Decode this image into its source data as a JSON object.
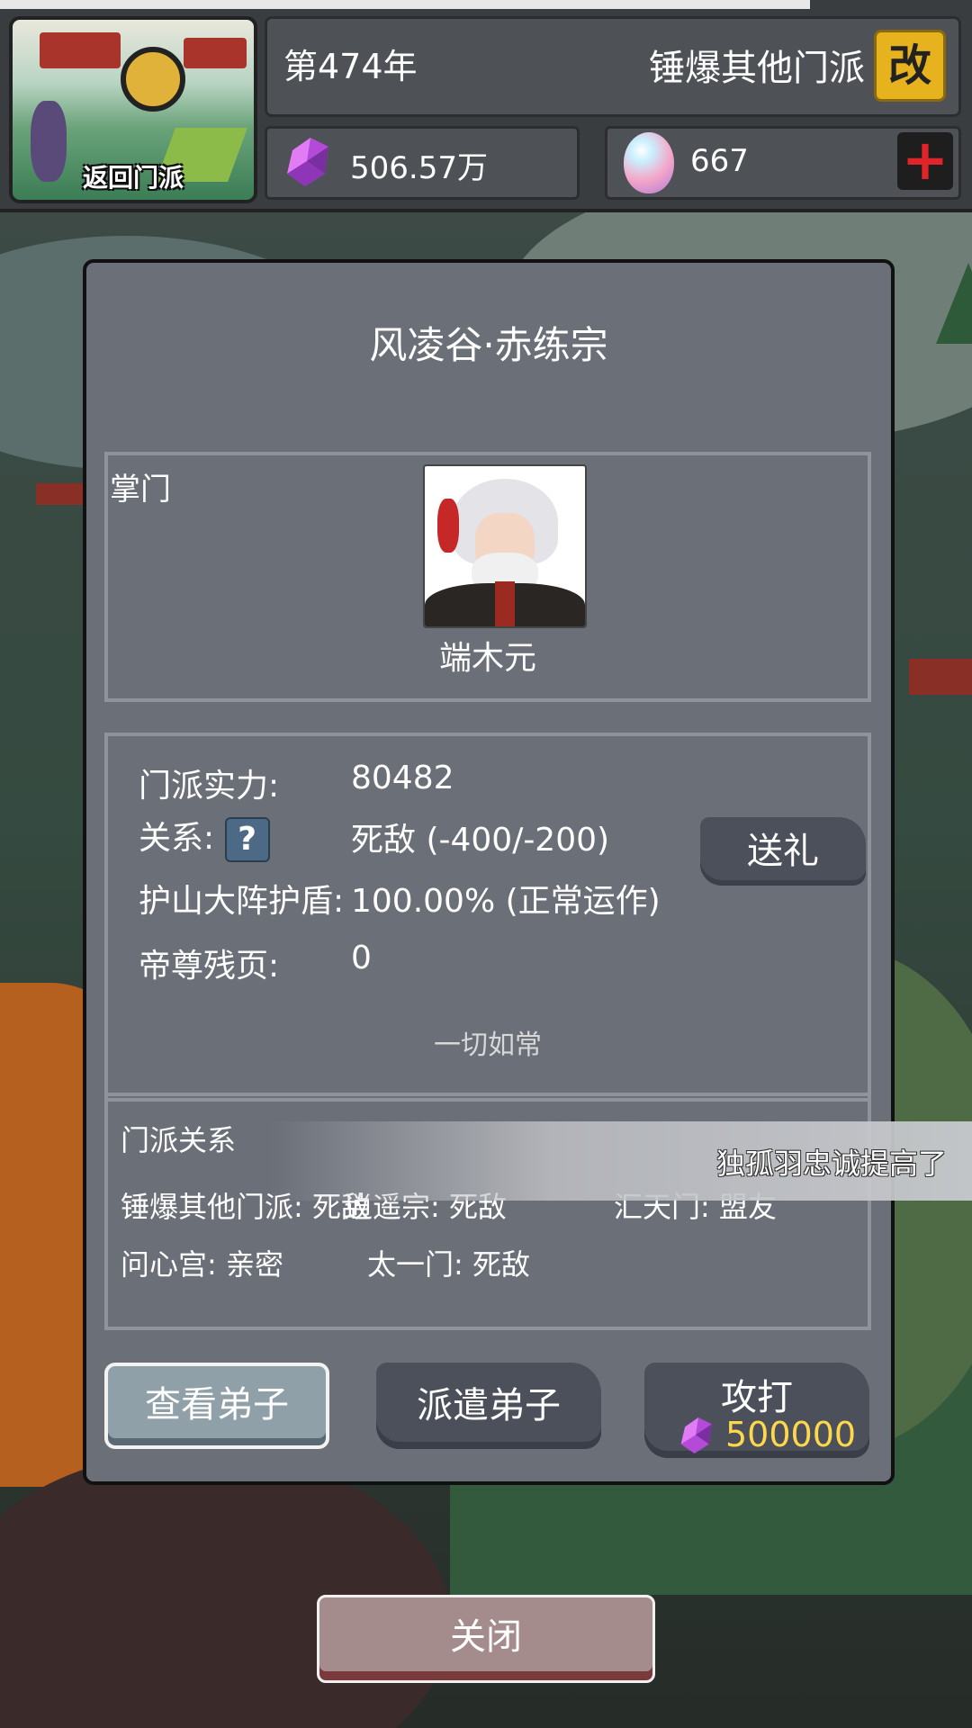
{
  "header": {
    "return_label": "返回门派",
    "year": "第474年",
    "sect_name": "锤爆其他门派",
    "rename_button": "改",
    "spirit_stones": "506.57万",
    "gems": "667",
    "add_button": "+"
  },
  "dialog": {
    "title": "风凌谷·赤练宗",
    "leader": {
      "section_label": "掌门",
      "name": "端木元"
    },
    "stats": {
      "power_label": "门派实力:",
      "power_value": "80482",
      "relation_label": "关系:",
      "relation_help": "?",
      "relation_value": "死敌  (-400/-200)",
      "shield_label": "护山大阵护盾:",
      "shield_value": "100.00% (正常运作)",
      "pages_label": "帝尊残页:",
      "pages_value": "0",
      "status_note": "一切如常",
      "gift_button": "送礼"
    },
    "relations": {
      "section_label": "门派关系",
      "items": [
        {
          "text": "锤爆其他门派: 死敌"
        },
        {
          "text": "逍遥宗: 死敌"
        },
        {
          "text": "汇天门: 盟友"
        },
        {
          "text": "问心宫: 亲密"
        },
        {
          "text": "太一门: 死敌"
        }
      ]
    },
    "buttons": {
      "view_disciples": "查看弟子",
      "dispatch_disciples": "派遣弟子",
      "attack": "攻打",
      "attack_cost": "500000"
    }
  },
  "toast": {
    "message": "独孤羽忠诚提高了"
  },
  "close_button": "关闭"
}
